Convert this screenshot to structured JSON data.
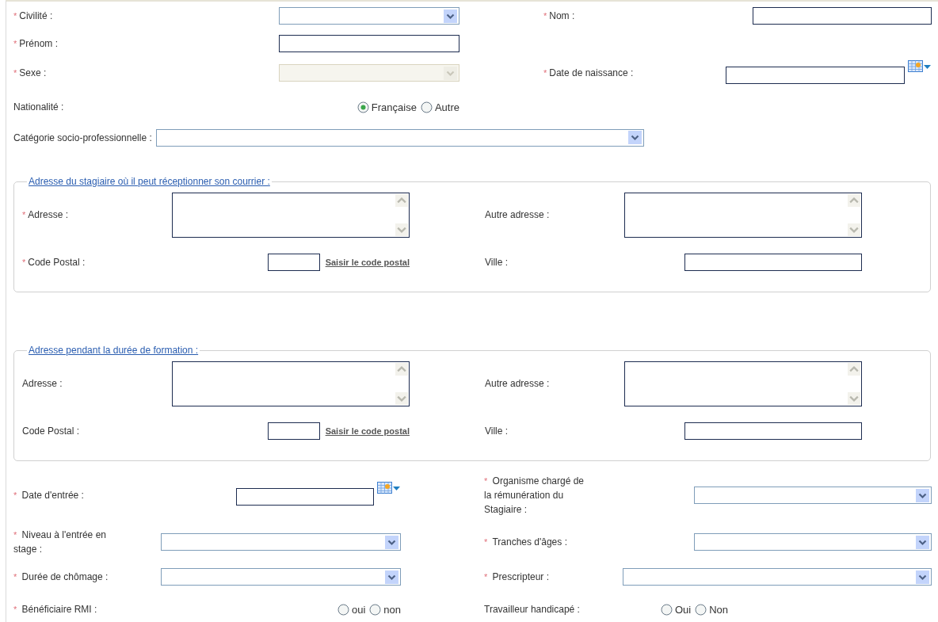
{
  "identity": {
    "rows": [
      {
        "left": {
          "mark": "*",
          "label": "Civilité :",
          "kind": "select",
          "disabled": false
        },
        "right": {
          "mark": "*",
          "label": "Nom :",
          "kind": "text"
        }
      },
      {
        "left": {
          "mark": "*",
          "label": "Prénom :",
          "kind": "text"
        }
      },
      {
        "left": {
          "mark": "*",
          "label": "Sexe :",
          "kind": "select",
          "disabled": true
        },
        "right": {
          "mark": "*",
          "label": "Date de naissance :",
          "kind": "date"
        }
      },
      {
        "left": {
          "label": "Nationalité :",
          "kind": "radio",
          "options": [
            {
              "label": "Française",
              "selected": true
            },
            {
              "label": "Autre",
              "selected": false
            }
          ]
        }
      },
      {
        "left": {
          "label": "Catégorie socio-professionnelle :",
          "kind": "select",
          "disabled": false
        }
      }
    ]
  },
  "sections": [
    {
      "legend": "Adresse du stagiaire où il peut réceptionner son courrier :",
      "rows": [
        {
          "left": {
            "mark": "*",
            "label": "Adresse :",
            "kind": "textarea"
          },
          "right": {
            "label": "Autre adresse :",
            "kind": "textarea"
          }
        },
        {
          "left": {
            "mark": "*",
            "label": "Code Postal :",
            "kind": "postal",
            "link": "Saisir le code postal"
          },
          "right": {
            "label": "Ville :",
            "kind": "text"
          }
        }
      ]
    },
    {
      "legend": "Adresse pendant la durée de formation :",
      "rows": [
        {
          "left": {
            "label": "Adresse :",
            "kind": "textarea"
          },
          "right": {
            "label": "Autre adresse :",
            "kind": "textarea"
          }
        },
        {
          "left": {
            "label": "Code Postal :",
            "kind": "postal",
            "link": "Saisir le code postal"
          },
          "right": {
            "label": "Ville :",
            "kind": "text"
          }
        }
      ]
    }
  ],
  "details": {
    "rows": [
      {
        "left": {
          "mark": "*",
          "label": "Date d'entrée :",
          "kind": "date"
        },
        "right": {
          "mark": "*",
          "label": "Organisme chargé de la rémunération du Stagiaire :",
          "kind": "select",
          "disabled": false
        }
      },
      {
        "left": {
          "mark": "*",
          "label": "Niveau à l'entrée en stage :",
          "kind": "select",
          "disabled": false
        },
        "right": {
          "mark": "*",
          "label": "Tranches d'âges :",
          "kind": "select",
          "disabled": false
        }
      },
      {
        "left": {
          "mark": "*",
          "label": "Durée de chômage :",
          "kind": "select",
          "disabled": false
        },
        "right": {
          "mark": "*",
          "label": "Prescripteur :",
          "kind": "select",
          "disabled": false
        }
      },
      {
        "left": {
          "mark": "*",
          "label": "Bénéficiaire RMI :",
          "kind": "radio",
          "options": [
            {
              "label": "oui",
              "selected": false
            },
            {
              "label": "non",
              "selected": false
            }
          ]
        },
        "right": {
          "label": "Travailleur handicapé :",
          "kind": "radio",
          "options": [
            {
              "label": "Oui",
              "selected": false
            },
            {
              "label": "Non",
              "selected": false
            }
          ]
        }
      }
    ]
  }
}
